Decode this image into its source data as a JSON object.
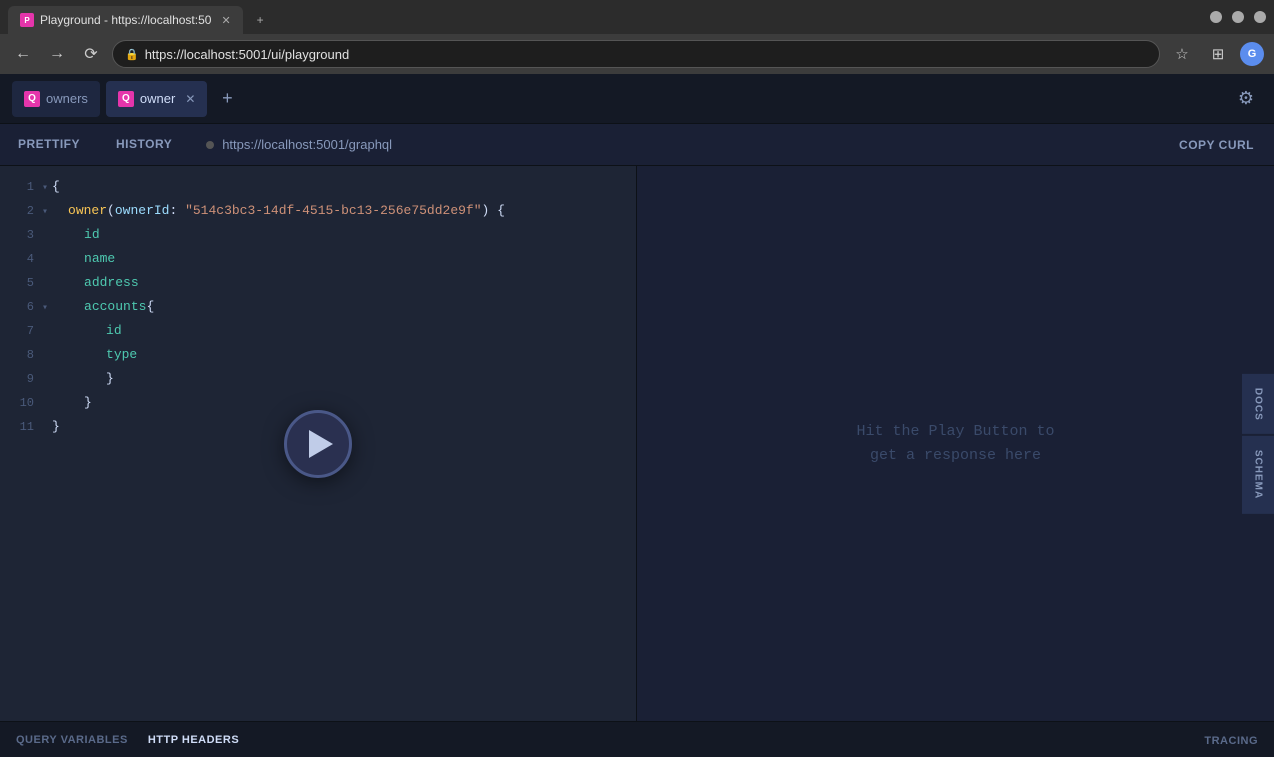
{
  "browser": {
    "tabs": [
      {
        "id": "tab1",
        "label": "Playground - https://localhost:50",
        "active": true,
        "favicon": "P"
      },
      {
        "id": "new-tab",
        "label": "+",
        "active": false
      }
    ],
    "address": "https://localhost:5001/ui/playground",
    "lock_icon": "🔒"
  },
  "app": {
    "title": "Playground",
    "settings_icon": "⚙",
    "tabs": [
      {
        "id": "owners-tab",
        "label": "owners",
        "active": false
      },
      {
        "id": "owner-tab",
        "label": "owner",
        "active": true
      }
    ],
    "add_tab_label": "+",
    "toolbar": {
      "prettify_label": "PRETTIFY",
      "history_label": "HISTORY",
      "endpoint": "https://localhost:5001/graphql",
      "copy_curl_label": "COPY CURL"
    },
    "editor": {
      "lines": [
        {
          "num": "1",
          "arrow": "▾",
          "content_type": "brace_open",
          "text": "{"
        },
        {
          "num": "2",
          "arrow": "▾",
          "content_type": "owner_call",
          "keyword": "owner",
          "param": "ownerId",
          "string": "\"514c3bc3-14df-4515-bc13-256e75dd2e9f\"",
          "punct": ") {"
        },
        {
          "num": "3",
          "arrow": "",
          "content_type": "field",
          "indent": 2,
          "text": "id"
        },
        {
          "num": "4",
          "arrow": "",
          "content_type": "field",
          "indent": 2,
          "text": "name"
        },
        {
          "num": "5",
          "arrow": "",
          "content_type": "field",
          "indent": 2,
          "text": "address"
        },
        {
          "num": "6",
          "arrow": "▾",
          "content_type": "field_brace",
          "indent": 2,
          "field": "accounts",
          "punct": " {"
        },
        {
          "num": "7",
          "arrow": "",
          "content_type": "field",
          "indent": 3,
          "text": "id"
        },
        {
          "num": "8",
          "arrow": "",
          "content_type": "field",
          "indent": 3,
          "text": "type"
        },
        {
          "num": "9",
          "arrow": "",
          "content_type": "brace_close",
          "indent": 3,
          "text": "}"
        },
        {
          "num": "10",
          "arrow": "",
          "content_type": "brace_close",
          "indent": 2,
          "text": "}"
        },
        {
          "num": "11",
          "arrow": "",
          "content_type": "brace_close",
          "indent": 0,
          "text": "}"
        }
      ]
    },
    "response": {
      "hint_line1": "Hit the Play Button to",
      "hint_line2": "get a response here"
    },
    "side_buttons": [
      {
        "id": "docs-btn",
        "label": "DOCS"
      },
      {
        "id": "schema-btn",
        "label": "SCHEMA"
      }
    ],
    "bottom_bar": {
      "query_variables_label": "QUERY VARIABLES",
      "http_headers_label": "HTTP HEADERS",
      "tracing_label": "TRACING"
    }
  }
}
